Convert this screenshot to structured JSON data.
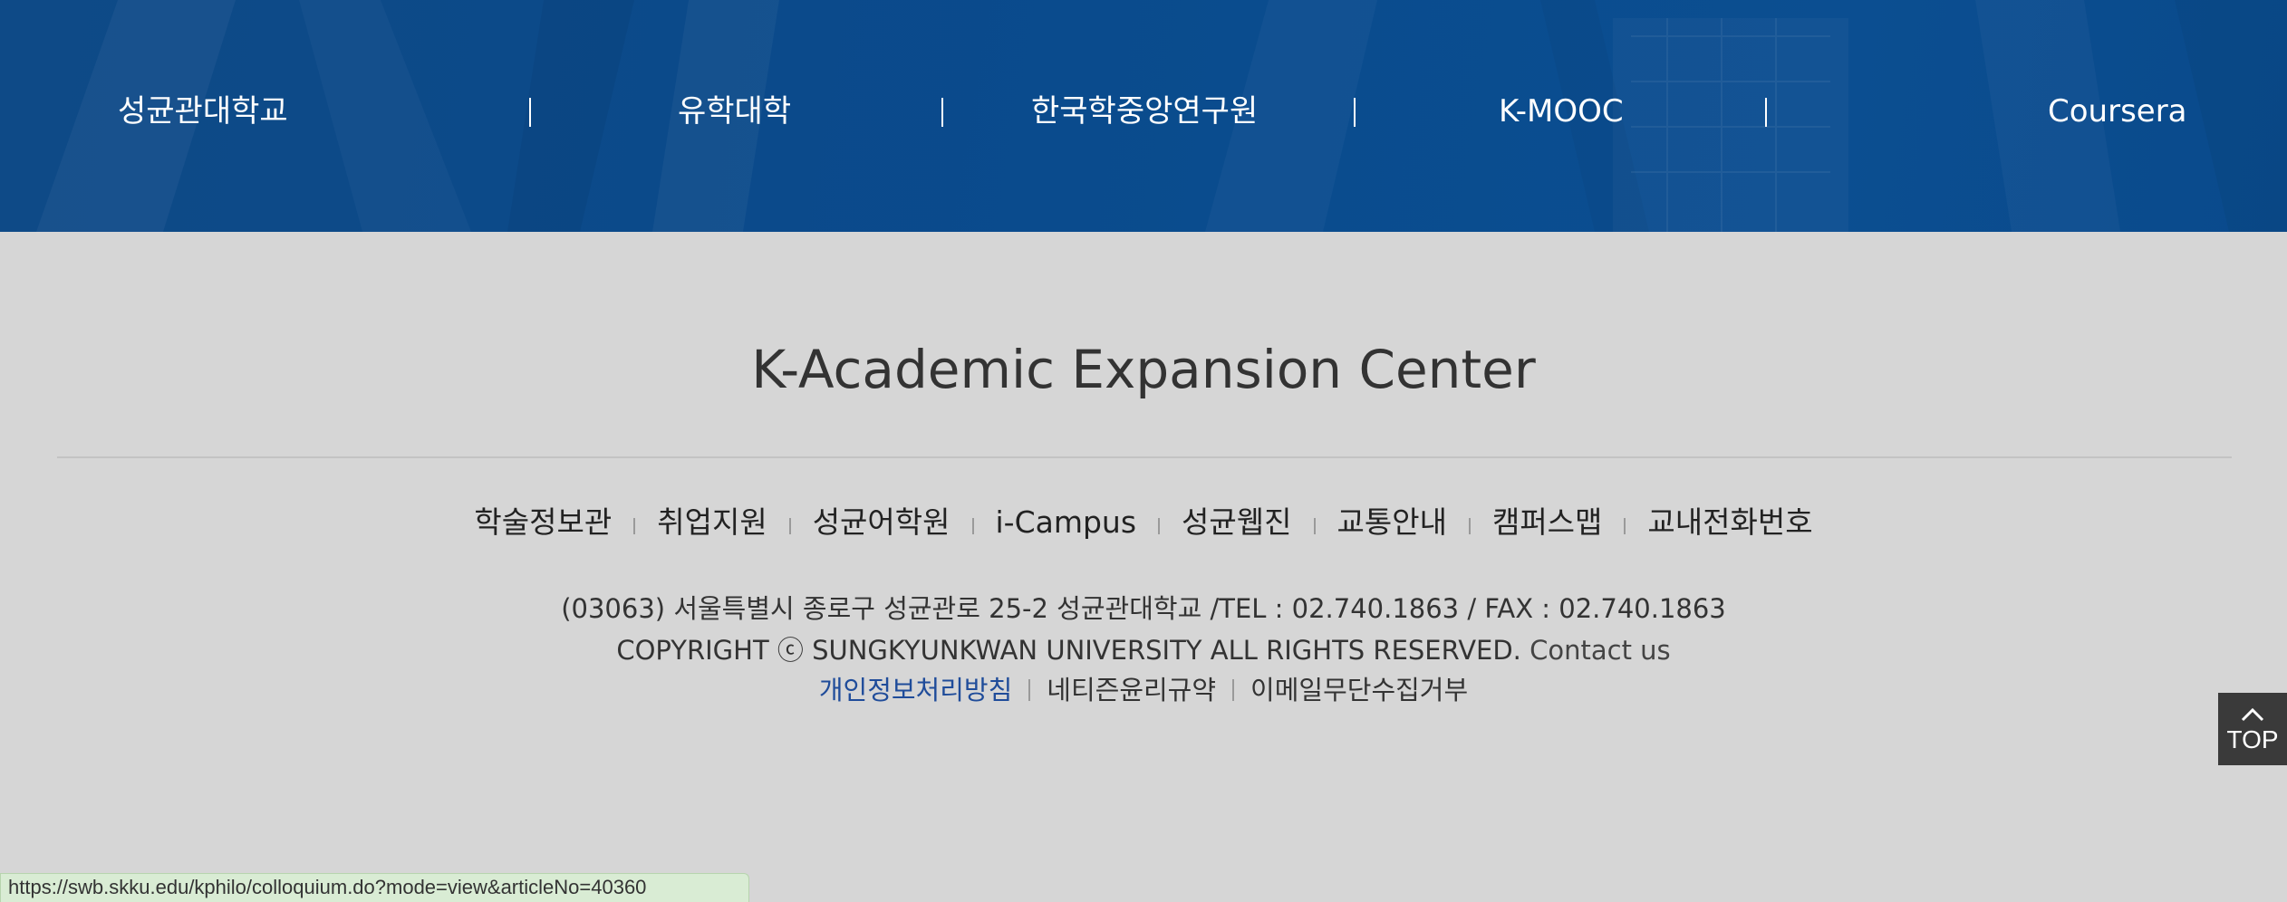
{
  "banner": {
    "links": [
      {
        "label": "성균관대학교"
      },
      {
        "label": "유학대학"
      },
      {
        "label": "한국학중앙연구원"
      },
      {
        "label": "K-MOOC"
      },
      {
        "label": "Coursera"
      }
    ]
  },
  "footer": {
    "title": "K-Academic Expansion Center",
    "quick_links": [
      {
        "label": "학술정보관"
      },
      {
        "label": "취업지원"
      },
      {
        "label": "성균어학원"
      },
      {
        "label": "i-Campus"
      },
      {
        "label": "성균웹진"
      },
      {
        "label": "교통안내"
      },
      {
        "label": "캠퍼스맵"
      },
      {
        "label": "교내전화번호"
      }
    ],
    "address": "(03063) 서울특별시 종로구 성균관로 25-2 성균관대학교 /TEL : 02.740.1863 / FAX : 02.740.1863",
    "copyright": "COPYRIGHT ⓒ  SUNGKYUNKWAN UNIVERSITY ALL RIGHTS RESERVED.",
    "contact_label": "Contact us",
    "policy_links": [
      {
        "label": "개인정보처리방침"
      },
      {
        "label": "네티즌윤리규약"
      },
      {
        "label": "이메일무단수집거부"
      }
    ]
  },
  "top_button": {
    "label": "TOP"
  },
  "status_bar": {
    "url": "https://swb.skku.edu/kphilo/colloquium.do?mode=view&articleNo=40360"
  },
  "colors": {
    "banner_blue": "#0b4a8a",
    "footer_bg": "#d6d6d6",
    "policy_highlight": "#1f4c9a",
    "top_button_bg": "#3a3a3a",
    "status_bar_bg": "#d9ecd4"
  }
}
